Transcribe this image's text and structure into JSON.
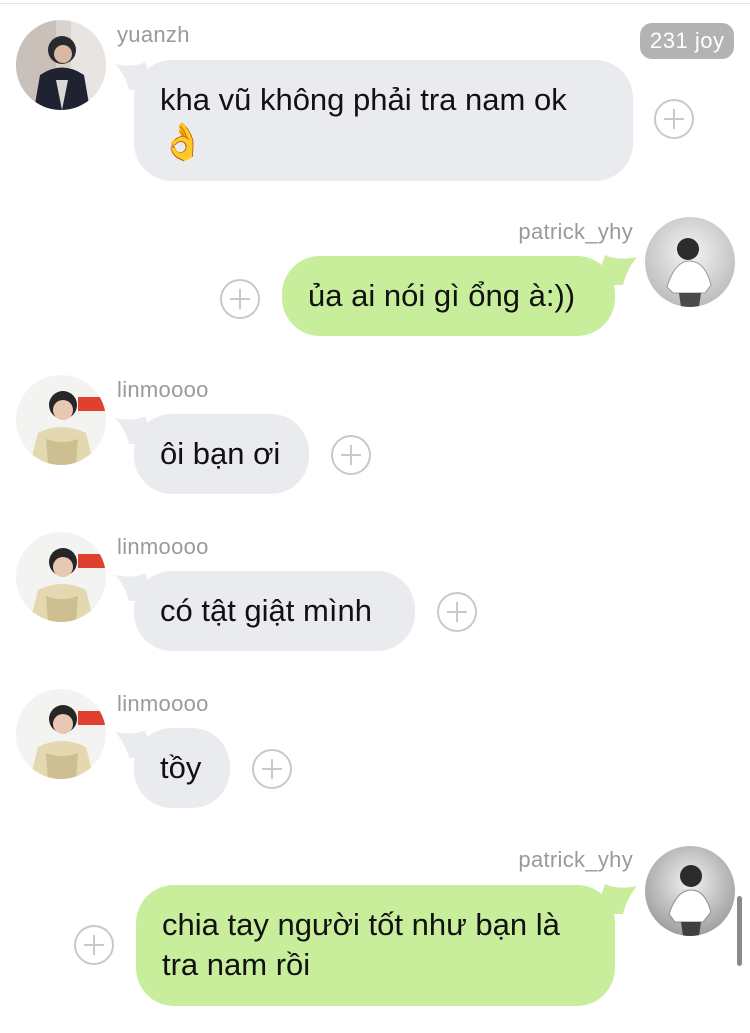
{
  "top_badge": "231 joy",
  "messages": [
    {
      "sender": "yuanzh",
      "text": "kha vũ không phải tra nam ok",
      "emoji": "👌",
      "side": "left"
    },
    {
      "sender": "patrick_yhy",
      "text": "ủa ai nói gì ổng à:))",
      "side": "right"
    },
    {
      "sender": "linmoooo",
      "text": "ôi bạn ơi",
      "side": "left"
    },
    {
      "sender": "linmoooo",
      "text": "có tật giật mình",
      "side": "left"
    },
    {
      "sender": "linmoooo",
      "text": "tồy",
      "side": "left"
    },
    {
      "sender": "patrick_yhy",
      "text": "chia tay người tốt như bạn là tra nam rồi",
      "side": "right"
    }
  ],
  "colors": {
    "incoming_bubble": "#e9ebee",
    "outgoing_bubble": "#c8ee9c",
    "username_text": "#9a9a9a",
    "badge_bg": "#b3b3b3"
  },
  "icons": {
    "react_button": "plus-circle-icon",
    "avatar": "user-photo"
  }
}
